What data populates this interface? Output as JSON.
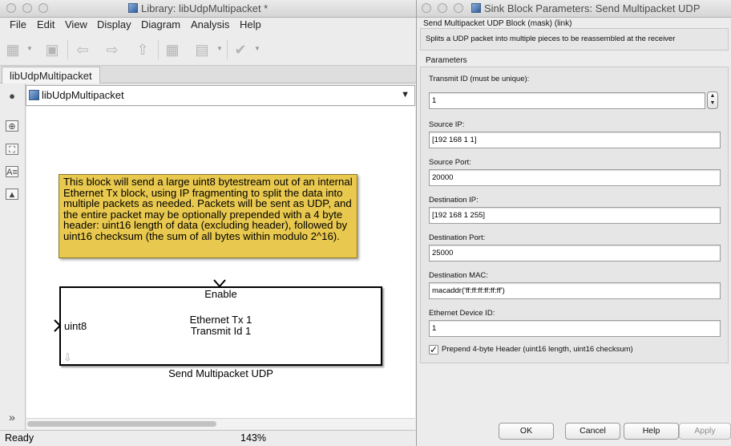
{
  "library_window": {
    "title": "Library: libUdpMultipacket *",
    "menu": [
      "File",
      "Edit",
      "View",
      "Display",
      "Diagram",
      "Analysis",
      "Help"
    ],
    "tab_label": "libUdpMultipacket",
    "address_path": "libUdpMultipacket",
    "annotation_text": "This block will send a large uint8 bytestream out of an internal Ethernet Tx block, using IP fragmenting to split the data into multiple packets as needed. Packets will be sent as UDP, and the entire packet may be optionally prepended with a 4 byte header: uint16 length of data (excluding header), followed by uint16 checksum (the sum of all bytes within modulo 2^16).",
    "block": {
      "enable_port": "Enable",
      "input_port": "uint8",
      "line1": "Ethernet Tx 1",
      "line2": "Transmit Id 1",
      "caption": "Send Multipacket UDP"
    },
    "status": {
      "state": "Ready",
      "zoom": "143%"
    }
  },
  "dialog": {
    "title": "Sink Block Parameters: Send Multipacket UDP",
    "block_type": "Send Multipacket UDP Block (mask) (link)",
    "description": "Splits a UDP packet into multiple pieces to be reassembled at the receiver",
    "parameters_heading": "Parameters",
    "fields": [
      {
        "label": "Transmit ID (must be unique):",
        "value": "1"
      },
      {
        "label": "Source IP:",
        "value": "[192 168 1 1]"
      },
      {
        "label": "Source Port:",
        "value": "20000"
      },
      {
        "label": "Destination IP:",
        "value": "[192 168 1 255]"
      },
      {
        "label": "Destination Port:",
        "value": "25000"
      },
      {
        "label": "Destination MAC:",
        "value": "macaddr('ff:ff:ff:ff:ff:ff')"
      },
      {
        "label": "Ethernet Device ID:",
        "value": "1"
      }
    ],
    "checkbox": {
      "label": "Prepend 4-byte Header (uint16 length, uint16 checksum)",
      "checked": true
    },
    "buttons": {
      "ok": "OK",
      "cancel": "Cancel",
      "help": "Help",
      "apply": "Apply"
    }
  }
}
